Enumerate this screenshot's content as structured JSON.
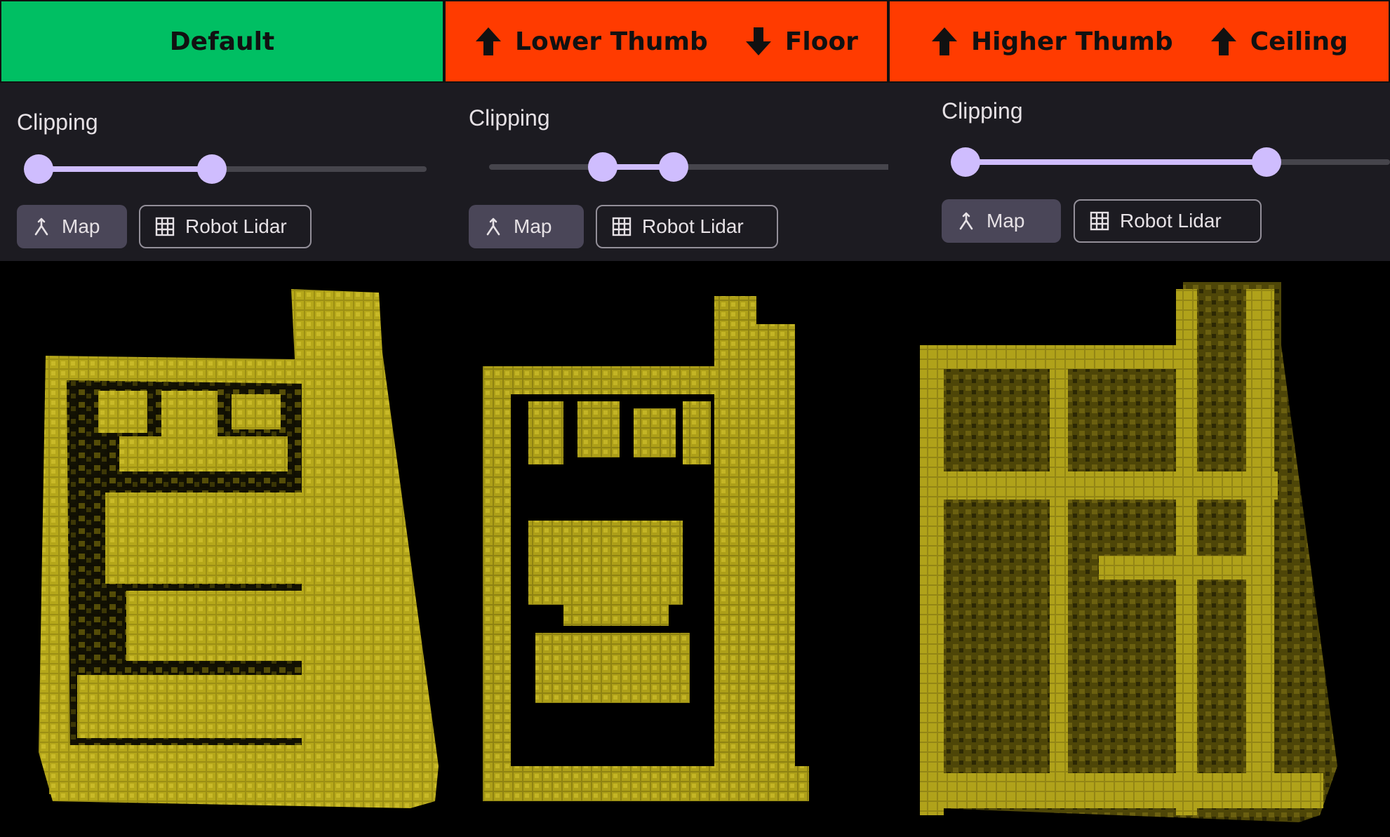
{
  "panels": [
    {
      "header": {
        "parts": [
          "Default"
        ],
        "status": "default",
        "color": "#00bf63"
      },
      "clipping": {
        "label": "Clipping",
        "lower": 0.0,
        "upper": 0.42
      },
      "chips": [
        {
          "label": "Map",
          "icon": "merge-icon",
          "selected": true
        },
        {
          "label": "Robot Lidar",
          "icon": "grid-icon",
          "selected": false
        }
      ]
    },
    {
      "header": {
        "parts": [
          "Lower Thumb",
          "Floor"
        ],
        "arrows": [
          "up",
          "down"
        ],
        "status": "changed",
        "color": "#ff3b00"
      },
      "clipping": {
        "label": "Clipping",
        "lower": 0.28,
        "upper": 0.45
      },
      "chips": [
        {
          "label": "Map",
          "icon": "merge-icon",
          "selected": true
        },
        {
          "label": "Robot Lidar",
          "icon": "grid-icon",
          "selected": false
        }
      ]
    },
    {
      "header": {
        "parts": [
          "Higher Thumb",
          "Ceiling"
        ],
        "arrows": [
          "up",
          "up"
        ],
        "status": "changed",
        "color": "#ff3b00"
      },
      "clipping": {
        "label": "Clipping",
        "lower": 0.0,
        "upper": 0.73
      },
      "chips": [
        {
          "label": "Map",
          "icon": "merge-icon",
          "selected": true
        },
        {
          "label": "Robot Lidar",
          "icon": "grid-icon",
          "selected": false
        }
      ]
    }
  ],
  "colors": {
    "control_bg": "#1c1b21",
    "slider_active": "#cfbdfe",
    "slider_inactive": "#46454c",
    "pointcloud": "#b5a71a"
  }
}
